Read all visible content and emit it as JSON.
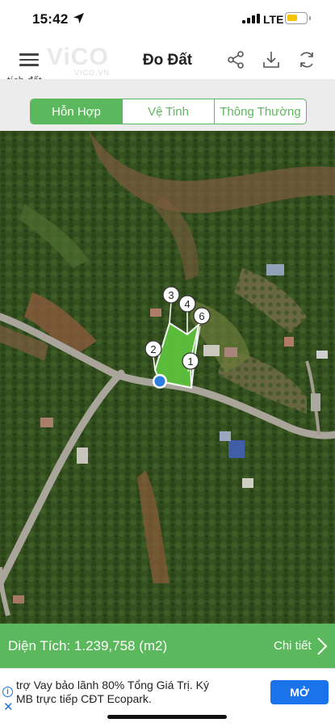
{
  "status_bar": {
    "time": "15:42",
    "carrier": "LTE",
    "battery_level": 0.55,
    "battery_color": "#f5c400"
  },
  "header": {
    "title": "Đo Đất",
    "watermark": "ViCO",
    "watermark_sub": "VICO.VN",
    "icons": [
      "menu-icon",
      "share-icon",
      "download-icon",
      "refresh-icon"
    ]
  },
  "cut_text": "tích đất.",
  "map_type": {
    "options": [
      "Hỗn Hợp",
      "Vệ Tinh",
      "Thông Thường"
    ],
    "selected": "Hỗn Hợp"
  },
  "map": {
    "vertex_labels": [
      "1",
      "2",
      "3",
      "4",
      "6"
    ],
    "polygon_color": "#5dc23c"
  },
  "area": {
    "label": "Diện Tích: 1.239,758 (m2)",
    "detail_link": "Chi tiết"
  },
  "ad": {
    "line1": "trợ Vay bảo lãnh 80% Tổng Giá Trị. Ký",
    "line2": "MB trực tiếp CĐT Ecopark.",
    "button": "MỞ"
  },
  "colors": {
    "accent": "#5cb85c",
    "ad_button": "#1a73e8"
  }
}
